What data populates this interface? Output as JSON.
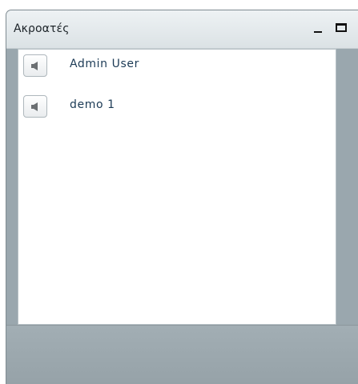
{
  "window": {
    "title": "Ακροατές",
    "minimize_icon": "minimize-icon",
    "maximize_icon": "maximize-icon"
  },
  "listeners": {
    "items": [
      {
        "name": "Admin User",
        "icon": "speaker-icon"
      },
      {
        "name": "demo 1",
        "icon": "speaker-icon"
      }
    ]
  },
  "colors": {
    "frame": "#9aa7ae",
    "titlebar": "#e3e9ec",
    "content_bg": "#ffffff",
    "label_text": "#1b3a55"
  }
}
